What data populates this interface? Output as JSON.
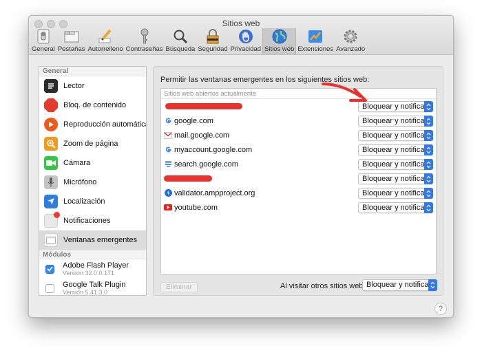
{
  "window": {
    "title": "Sitios web"
  },
  "toolbar": [
    {
      "label": "General",
      "icon": "switch-icon"
    },
    {
      "label": "Pestañas",
      "icon": "tabs-icon"
    },
    {
      "label": "Autorrelleno",
      "icon": "pencil-icon"
    },
    {
      "label": "Contraseñas",
      "icon": "key-icon"
    },
    {
      "label": "Búsqueda",
      "icon": "magnifier-icon"
    },
    {
      "label": "Seguridad",
      "icon": "lock-icon"
    },
    {
      "label": "Privacidad",
      "icon": "hand-icon"
    },
    {
      "label": "Sitios web",
      "icon": "globe-icon",
      "active": true
    },
    {
      "label": "Extensiones",
      "icon": "puzzle-icon"
    },
    {
      "label": "Avanzado",
      "icon": "gear-icon"
    }
  ],
  "sidebar": {
    "general_header": "General",
    "items": [
      {
        "label": "Lector",
        "icon": "reader-icon",
        "color": "#2b2b2b"
      },
      {
        "label": "Bloq. de contenido",
        "icon": "stop-sign-icon",
        "color": "#e33b2e"
      },
      {
        "label": "Reproducción automática",
        "icon": "play-icon",
        "color": "#ee5a1a"
      },
      {
        "label": "Zoom de página",
        "icon": "zoom-icon",
        "color": "#f29a1d"
      },
      {
        "label": "Cámara",
        "icon": "camera-icon",
        "color": "#33c748"
      },
      {
        "label": "Micrófono",
        "icon": "microphone-icon",
        "color": "#b7b7b7"
      },
      {
        "label": "Localización",
        "icon": "location-arrow-icon",
        "color": "#2f7ce0"
      },
      {
        "label": "Notificaciones",
        "icon": "notification-badge-icon",
        "color": "#e9e9e9"
      },
      {
        "label": "Ventanas emergentes",
        "icon": "popup-window-icon",
        "color": "#f2f2f2",
        "selected": true
      }
    ],
    "modules_header": "Módulos",
    "plugins": [
      {
        "name": "Adobe Flash Player",
        "version": "Versión 32.0.0.171",
        "checked": true
      },
      {
        "name": "Google Talk Plugin",
        "version": "Versión 5.41.3.0",
        "checked": false
      }
    ]
  },
  "panel": {
    "prompt": "Permitir las ventanas emergentes en los siguientes sitios web:",
    "list_header": "Sitios web abiertos actualmente",
    "sites": [
      {
        "name": "",
        "icon": "",
        "redacted": true,
        "setting": "Bloquear y notificar"
      },
      {
        "name": "google.com",
        "icon": "google-icon",
        "setting": "Bloquear y notificar"
      },
      {
        "name": "mail.google.com",
        "icon": "gmail-icon",
        "setting": "Bloquear y notificar"
      },
      {
        "name": "myaccount.google.com",
        "icon": "google-icon",
        "setting": "Bloquear y notificar"
      },
      {
        "name": "search.google.com",
        "icon": "search-console-icon",
        "setting": "Bloquear y notificar"
      },
      {
        "name": "",
        "icon": "",
        "redacted": true,
        "setting": "Bloquear y notificar"
      },
      {
        "name": "validator.ampproject.org",
        "icon": "amp-icon",
        "setting": "Bloquear y notificar"
      },
      {
        "name": "youtube.com",
        "icon": "youtube-icon",
        "setting": "Bloquear y notificar"
      }
    ],
    "remove_button": "Eliminar",
    "other_sites_label": "Al visitar otros sitios web:",
    "other_sites_setting": "Bloquear y notificar"
  },
  "help_label": "?",
  "colors": {
    "accent": "#3478e8",
    "annotation_red": "#e8322e"
  }
}
